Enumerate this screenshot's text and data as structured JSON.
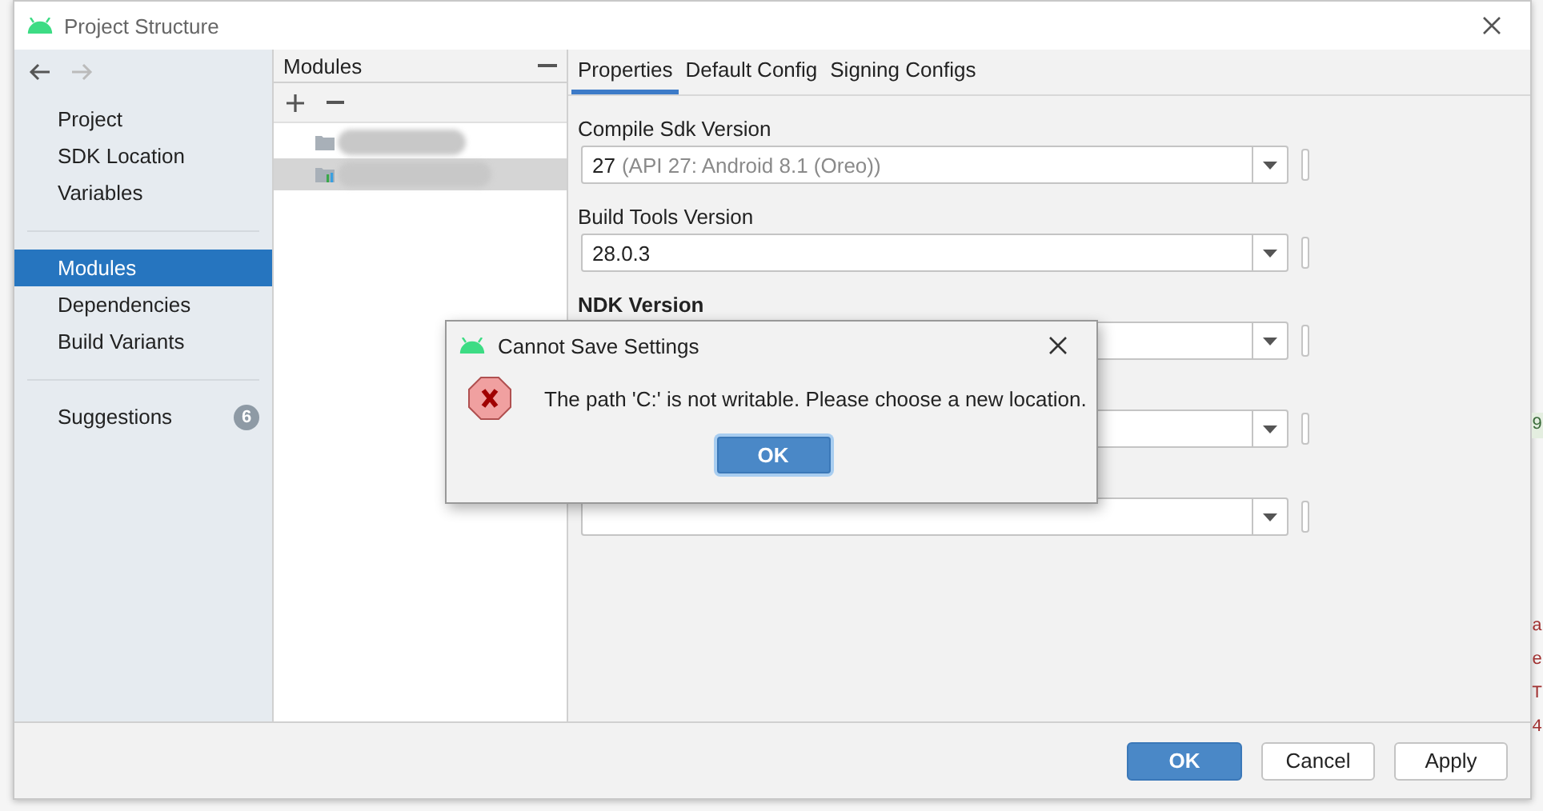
{
  "window": {
    "title": "Project Structure"
  },
  "nav": {
    "back_disabled": false,
    "forward_disabled": true
  },
  "sidebar": {
    "groups": [
      [
        {
          "label": "Project",
          "selected": false
        },
        {
          "label": "SDK Location",
          "selected": false
        },
        {
          "label": "Variables",
          "selected": false
        }
      ],
      [
        {
          "label": "Modules",
          "selected": true
        },
        {
          "label": "Dependencies",
          "selected": false
        },
        {
          "label": "Build Variants",
          "selected": false
        }
      ],
      [
        {
          "label": "Suggestions",
          "selected": false,
          "badge": "6"
        }
      ]
    ]
  },
  "modules_panel": {
    "title": "Modules",
    "rows": [
      {
        "selected": false
      },
      {
        "selected": true
      }
    ]
  },
  "tabs": [
    {
      "label": "Properties",
      "selected": true
    },
    {
      "label": "Default Config",
      "selected": false
    },
    {
      "label": "Signing Configs",
      "selected": false
    }
  ],
  "fields": [
    {
      "kind": "combo",
      "label": "Compile Sdk Version",
      "value": "27",
      "hint": "(API 27: Android 8.1 (Oreo))"
    },
    {
      "kind": "combo",
      "label": "Build Tools Version",
      "value": "28.0.3"
    },
    {
      "kind": "combo",
      "label": "NDK Version"
    },
    {
      "kind": "combo"
    },
    {
      "kind": "combo"
    }
  ],
  "dialog": {
    "title": "Cannot Save Settings",
    "message": "The path 'C:' is not writable. Please choose a new location.",
    "button": "OK"
  },
  "footer": {
    "buttons": [
      {
        "label": "OK",
        "kind": "primary"
      },
      {
        "label": "Cancel",
        "kind": "default"
      },
      {
        "label": "Apply",
        "kind": "default"
      }
    ]
  },
  "background_editor": {
    "edge_chars": [
      {
        "text": "9",
        "kind": "green"
      },
      {
        "text": "a",
        "kind": "red"
      },
      {
        "text": "e",
        "kind": "red"
      },
      {
        "text": "T",
        "kind": "red"
      },
      {
        "text": "4",
        "kind": "red"
      }
    ]
  }
}
